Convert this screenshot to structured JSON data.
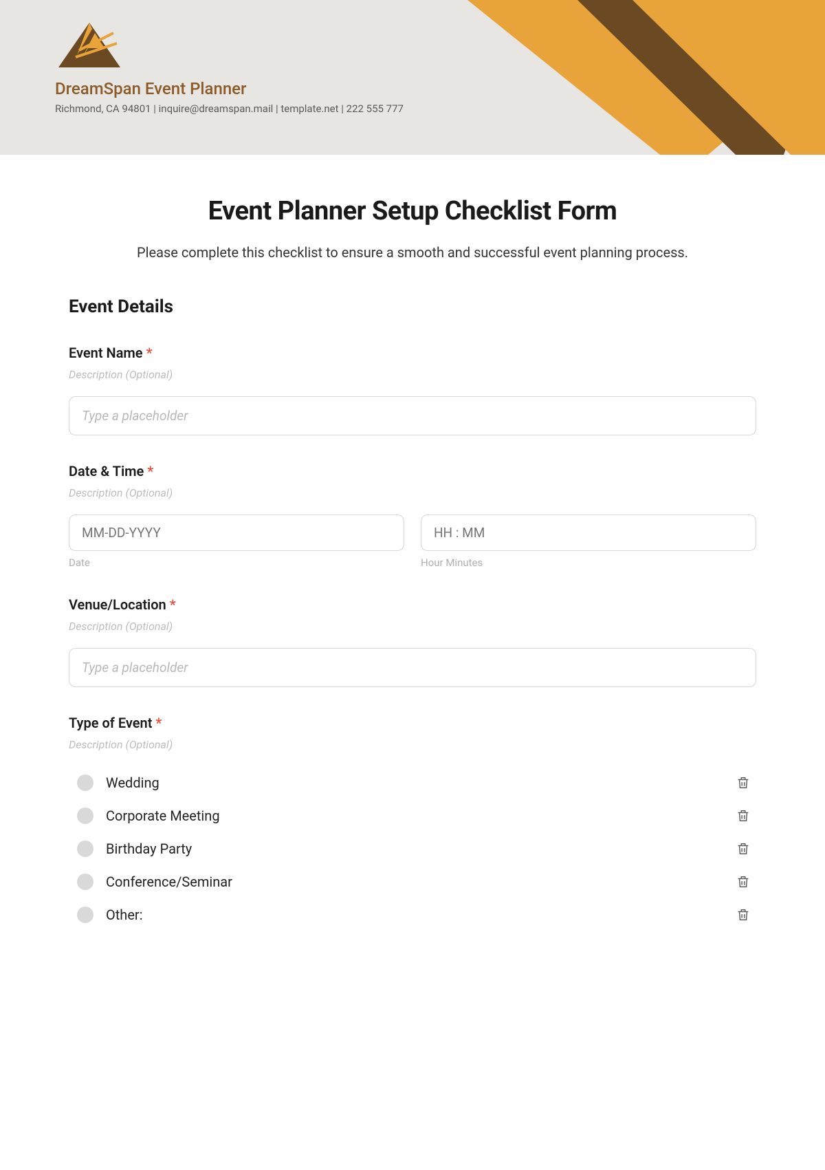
{
  "header": {
    "company_name": "DreamSpan Event Planner",
    "contact_line": "Richmond, CA 94801 | inquire@dreamspan.mail | template.net | 222 555 777"
  },
  "form": {
    "title": "Event Planner Setup Checklist Form",
    "subtitle": "Please complete this checklist to ensure a smooth and successful event planning process.",
    "section_title": "Event Details",
    "required_mark": "*",
    "desc_placeholder": "Description (Optional)"
  },
  "fields": {
    "event_name": {
      "label": "Event Name",
      "placeholder": "Type a placeholder"
    },
    "date_time": {
      "label": "Date & Time",
      "date_placeholder": "MM-DD-YYYY",
      "time_placeholder": "HH : MM",
      "date_sublabel": "Date",
      "time_sublabel": "Hour Minutes"
    },
    "venue": {
      "label": "Venue/Location",
      "placeholder": "Type a placeholder"
    },
    "type_of_event": {
      "label": "Type of Event",
      "options": [
        "Wedding",
        "Corporate Meeting",
        "Birthday Party",
        "Conference/Seminar",
        "Other:"
      ]
    }
  }
}
